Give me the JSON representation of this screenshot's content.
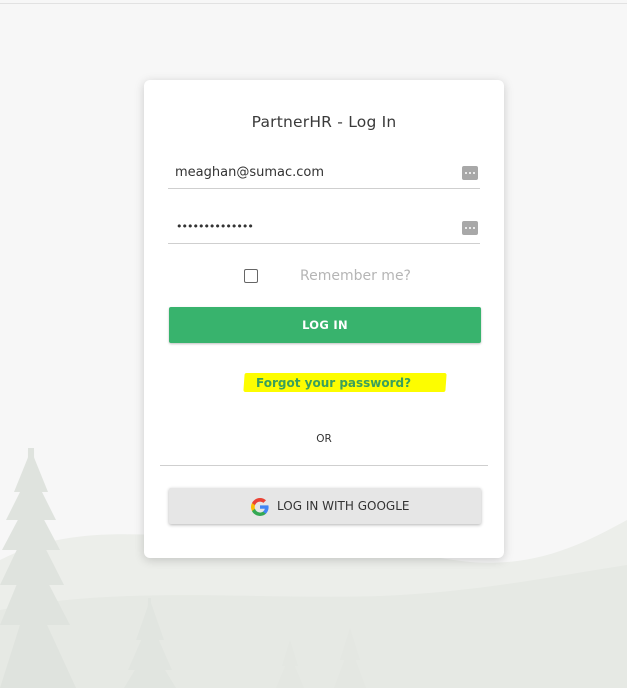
{
  "login": {
    "title": "PartnerHR - Log In",
    "email_value": "meaghan@sumac.com",
    "password_masked": "••••••••••••••",
    "remember_label": "Remember me?",
    "remember_checked": false,
    "login_button": "LOG IN",
    "forgot_link": "Forgot your password?",
    "or_text": "OR",
    "google_button": "LOG IN WITH GOOGLE"
  },
  "icons": {
    "field_icon": "password-manager-icon",
    "google_icon": "google-logo-icon"
  },
  "colors": {
    "primary": "#38b36d",
    "link": "#3aa05c",
    "highlight": "#fdfd00",
    "background": "#f7f7f7"
  }
}
